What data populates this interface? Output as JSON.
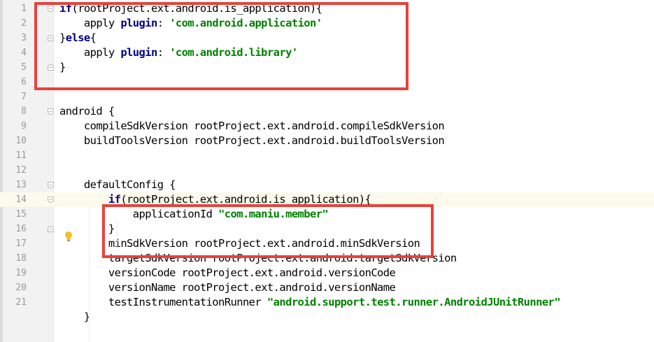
{
  "editor": {
    "lines": [
      {
        "n": "1",
        "tokens": [
          {
            "t": "if",
            "c": "kw"
          },
          {
            "t": "(rootProject.ext.android.is_application){",
            "c": ""
          }
        ]
      },
      {
        "n": "2",
        "tokens": [
          {
            "t": "    apply ",
            "c": ""
          },
          {
            "t": "plugin",
            "c": "plug"
          },
          {
            "t": ": ",
            "c": ""
          },
          {
            "t": "'com.android.application'",
            "c": "str"
          }
        ]
      },
      {
        "n": "3",
        "tokens": [
          {
            "t": "}",
            "c": ""
          },
          {
            "t": "else",
            "c": "kw"
          },
          {
            "t": "{",
            "c": ""
          }
        ]
      },
      {
        "n": "4",
        "tokens": [
          {
            "t": "    apply ",
            "c": ""
          },
          {
            "t": "plugin",
            "c": "plug"
          },
          {
            "t": ": ",
            "c": ""
          },
          {
            "t": "'com.android.library'",
            "c": "str"
          }
        ]
      },
      {
        "n": "5",
        "tokens": [
          {
            "t": "}",
            "c": ""
          }
        ]
      },
      {
        "n": "6",
        "tokens": []
      },
      {
        "n": "7",
        "tokens": []
      },
      {
        "n": "8",
        "tokens": [
          {
            "t": "android {",
            "c": ""
          }
        ]
      },
      {
        "n": "9",
        "tokens": [
          {
            "t": "    compileSdkVersion rootProject.ext.android.compileSdkVersion",
            "c": ""
          }
        ]
      },
      {
        "n": "10",
        "tokens": [
          {
            "t": "    buildToolsVersion rootProject.ext.android.buildToolsVersion",
            "c": ""
          }
        ]
      },
      {
        "n": "11",
        "tokens": []
      },
      {
        "n": "12",
        "tokens": []
      },
      {
        "n": "13",
        "tokens": [
          {
            "t": "    defaultConfig {",
            "c": ""
          }
        ]
      },
      {
        "n": "14",
        "tokens": [
          {
            "t": "        ",
            "c": ""
          },
          {
            "t": "if",
            "c": "kw"
          },
          {
            "t": "(rootProject.ext.android.is_application){",
            "c": ""
          }
        ]
      },
      {
        "n": "15",
        "tokens": [
          {
            "t": "            applicationId ",
            "c": ""
          },
          {
            "t": "\"com.maniu.member\"",
            "c": "str"
          }
        ]
      },
      {
        "n": "16",
        "tokens": [
          {
            "t": "        }",
            "c": ""
          }
        ]
      },
      {
        "n": "17",
        "tokens": [
          {
            "t": "        minSdkVersion rootProject.ext.android.minSdkVersion",
            "c": ""
          }
        ]
      },
      {
        "n": "18",
        "tokens": [
          {
            "t": "        targetSdkVersion rootProject.ext.android.targetSdkVersion",
            "c": ""
          }
        ]
      },
      {
        "n": "19",
        "tokens": [
          {
            "t": "        versionCode rootProject.ext.android.versionCode",
            "c": ""
          }
        ]
      },
      {
        "n": "20",
        "tokens": [
          {
            "t": "        versionName rootProject.ext.android.versionName",
            "c": ""
          }
        ]
      },
      {
        "n": "21",
        "tokens": [
          {
            "t": "        testInstrumentationRunner ",
            "c": ""
          },
          {
            "t": "\"android.support.test.runner.AndroidJUnitRunner\"",
            "c": "str"
          }
        ]
      },
      {
        "n": "",
        "tokens": [
          {
            "t": "    }",
            "c": ""
          }
        ]
      }
    ],
    "current_line": "14",
    "colors": {
      "highlight_box": "#e8413a",
      "keyword": "#000080",
      "string": "#008000",
      "current_line_bg": "#fcfaed",
      "gutter_bg": "#f2f2f2"
    },
    "icons": {
      "bulb": "intention-bulb-icon",
      "fold": "fold-marker-icon"
    }
  }
}
